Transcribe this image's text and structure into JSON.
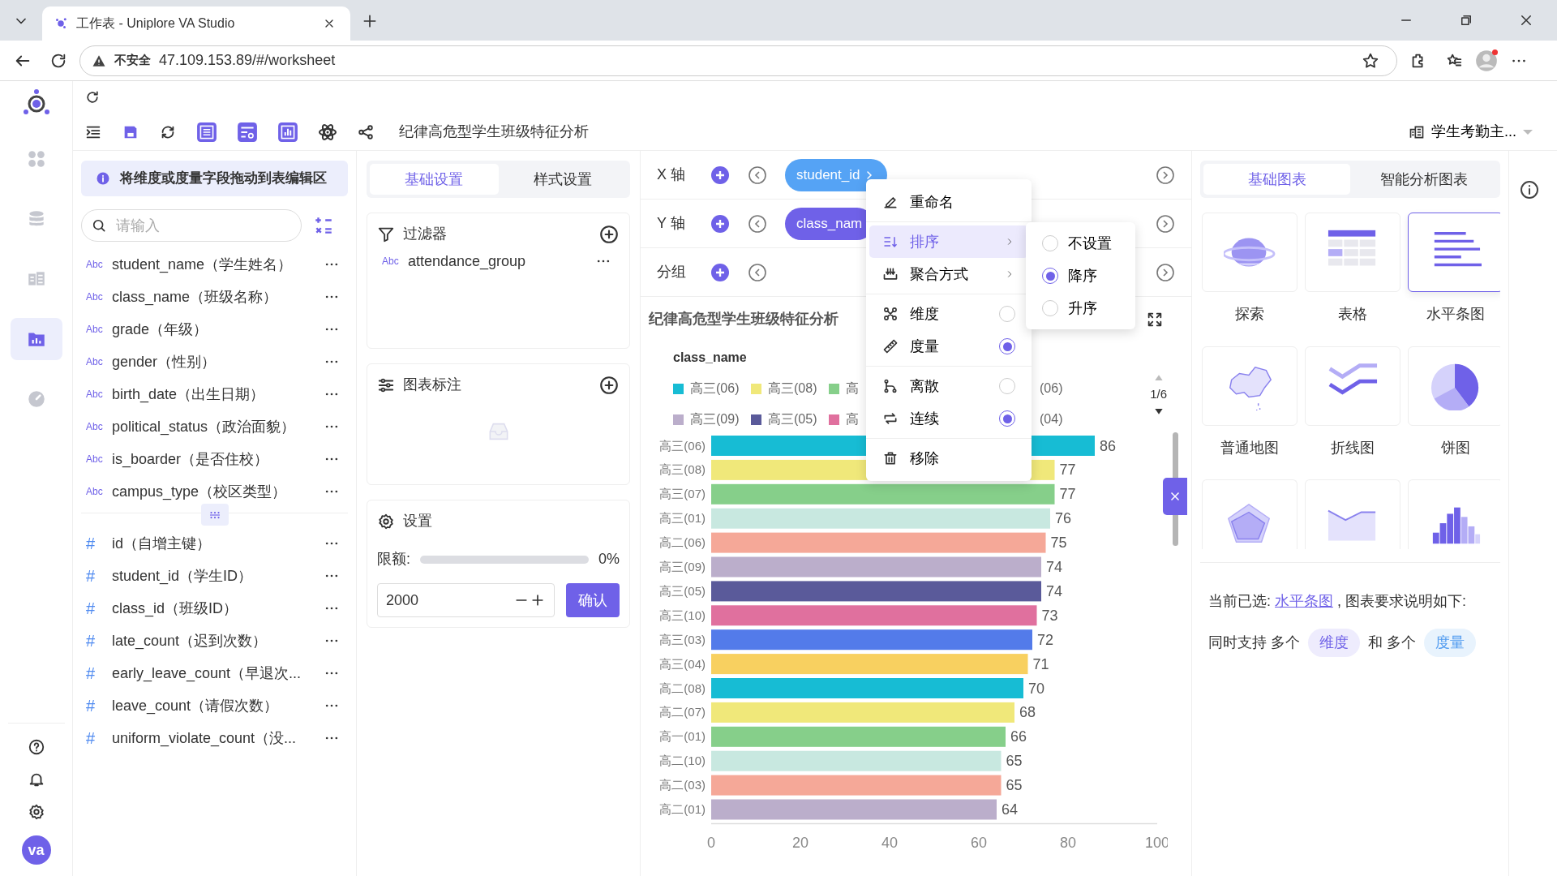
{
  "browser": {
    "tab": {
      "title": "工作表 - Uniplore VA Studio"
    },
    "address": {
      "security": "不安全",
      "url": "47.109.153.89/#/worksheet"
    }
  },
  "nav_rail": {
    "items": [
      {
        "selected": false
      },
      {
        "selected": false
      },
      {
        "selected": false
      },
      {
        "selected": true
      },
      {
        "selected": false
      }
    ],
    "avatar": "va"
  },
  "toolbar": {
    "title": "纪律高危型学生班级特征分析",
    "dataset": "学生考勤主..."
  },
  "fields": {
    "hint": "将维度或度量字段拖动到表编辑区",
    "search": {
      "placeholder": "请输入"
    },
    "items": [
      {
        "kind": "dimension",
        "tag": "Abc",
        "name": "student_name（学生姓名）"
      },
      {
        "kind": "dimension",
        "tag": "Abc",
        "name": "class_name（班级名称）"
      },
      {
        "kind": "dimension",
        "tag": "Abc",
        "name": "grade（年级）"
      },
      {
        "kind": "dimension",
        "tag": "Abc",
        "name": "gender（性别）"
      },
      {
        "kind": "dimension",
        "tag": "Abc",
        "name": "birth_date（出生日期）"
      },
      {
        "kind": "dimension",
        "tag": "Abc",
        "name": "political_status（政治面貌）"
      },
      {
        "kind": "dimension",
        "tag": "Abc",
        "name": "is_boarder（是否住校）"
      },
      {
        "kind": "dimension",
        "tag": "Abc",
        "name": "campus_type（校区类型）"
      },
      {
        "kind": "measure",
        "tag": "#",
        "name": "id（自增主键）"
      },
      {
        "kind": "measure",
        "tag": "#",
        "name": "student_id（学生ID）"
      },
      {
        "kind": "measure",
        "tag": "#",
        "name": "class_id（班级ID）"
      },
      {
        "kind": "measure",
        "tag": "#",
        "name": "late_count（迟到次数）"
      },
      {
        "kind": "measure",
        "tag": "#",
        "name": "early_leave_count（早退次..."
      },
      {
        "kind": "measure",
        "tag": "#",
        "name": "leave_count（请假次数）"
      },
      {
        "kind": "measure",
        "tag": "#",
        "name": "uniform_violate_count（没..."
      }
    ]
  },
  "settings_tabs": [
    {
      "label": "基础设置",
      "selected": true
    },
    {
      "label": "样式设置",
      "selected": false
    }
  ],
  "filter": {
    "title": "过滤器",
    "items": [
      {
        "tag": "Abc",
        "name": "attendance_group"
      }
    ]
  },
  "annotation": {
    "title": "图表标注"
  },
  "limit": {
    "title": "设置",
    "label": "限额:",
    "level": 0,
    "reading": "0%",
    "value": "2000",
    "confirm": "确认"
  },
  "axes": [
    {
      "label": "X 轴",
      "pill": {
        "text": "student_id",
        "color": "#55a3f5"
      }
    },
    {
      "label": "Y 轴",
      "pill": {
        "text": "class_nam",
        "color": "#6f61e8"
      }
    },
    {
      "label": "分组"
    }
  ],
  "chart": {
    "title": "纪律高危型学生班级特征分析",
    "legend": {
      "title": "class_name",
      "page": "1/6",
      "rows": [
        [
          {
            "label": "高三(06)",
            "color": "#17bcd4"
          },
          {
            "label": "高三(08)",
            "color": "#f0e87a"
          },
          {
            "label": "高",
            "color": "#86cf8a"
          },
          {
            "label": "(06)"
          }
        ],
        [
          {
            "label": "高三(09)",
            "color": "#bbaecb"
          },
          {
            "label": "高三(05)",
            "color": "#5a5a9a"
          },
          {
            "label": "高",
            "color": "#e0709e"
          },
          {
            "label": "(04)"
          }
        ]
      ]
    },
    "chart_data": {
      "type": "bar",
      "orientation": "horizontal",
      "categories": [
        "高三(06)",
        "高三(08)",
        "高三(07)",
        "高三(01)",
        "高二(06)",
        "高三(09)",
        "高三(05)",
        "高三(10)",
        "高三(03)",
        "高三(04)",
        "高二(08)",
        "高二(07)",
        "高一(01)",
        "高二(10)",
        "高二(03)",
        "高二(01)"
      ],
      "values": [
        86,
        77,
        77,
        76,
        75,
        74,
        74,
        73,
        72,
        71,
        70,
        68,
        66,
        65,
        65,
        64
      ],
      "colors": [
        "#17bcd4",
        "#f0e87a",
        "#86cf8a",
        "#c8e8e0",
        "#f5a898",
        "#bbaecb",
        "#5a5a9a",
        "#e0709e",
        "#537bea",
        "#f8d060",
        "#17bcd4",
        "#f0e87a",
        "#86cf8a",
        "#c8e8e0",
        "#f5a898",
        "#bbaecb"
      ],
      "xlim": [
        0,
        100
      ],
      "xticks": [
        0,
        20,
        40,
        60,
        80,
        100
      ],
      "data_labels": true
    }
  },
  "context_menu": {
    "sections": [
      {
        "items": [
          {
            "kind": "action",
            "label": "重命名"
          }
        ]
      },
      {
        "items": [
          {
            "kind": "submenu",
            "label": "排序",
            "selected": true
          },
          {
            "kind": "submenu",
            "label": "聚合方式",
            "selected": false
          }
        ]
      },
      {
        "items": [
          {
            "kind": "radio",
            "label": "维度",
            "checked": false
          },
          {
            "kind": "radio",
            "label": "度量",
            "checked": true
          }
        ]
      },
      {
        "items": [
          {
            "kind": "radio",
            "label": "离散",
            "checked": false
          },
          {
            "kind": "radio",
            "label": "连续",
            "checked": true
          }
        ]
      },
      {
        "items": [
          {
            "kind": "action",
            "label": "移除"
          }
        ]
      }
    ],
    "submenu": [
      {
        "label": "不设置",
        "selected": false
      },
      {
        "label": "降序",
        "selected": true
      },
      {
        "label": "升序",
        "selected": false
      }
    ]
  },
  "chart_types": {
    "tabs": [
      {
        "label": "基础图表",
        "selected": true
      },
      {
        "label": "智能分析图表",
        "selected": false
      }
    ],
    "items": [
      {
        "kind": "explore",
        "label": "探索",
        "selected": false
      },
      {
        "kind": "table",
        "label": "表格",
        "selected": false
      },
      {
        "kind": "hbar",
        "label": "水平条图",
        "selected": true
      },
      {
        "kind": "map",
        "label": "普通地图",
        "selected": false
      },
      {
        "kind": "line",
        "label": "折线图",
        "selected": false
      },
      {
        "kind": "pie",
        "label": "饼图",
        "selected": false
      },
      {
        "kind": "radar",
        "selected": false
      },
      {
        "kind": "area",
        "selected": false
      },
      {
        "kind": "histogram",
        "selected": false
      }
    ],
    "note": {
      "prefix": "当前已选:",
      "link": "水平条图",
      "suffix": ", 图表要求说明如下:"
    },
    "support": {
      "text_1": "同时支持 多个",
      "tag_1": "维度",
      "text_2": "和 多个",
      "tag_2": "度量"
    }
  }
}
